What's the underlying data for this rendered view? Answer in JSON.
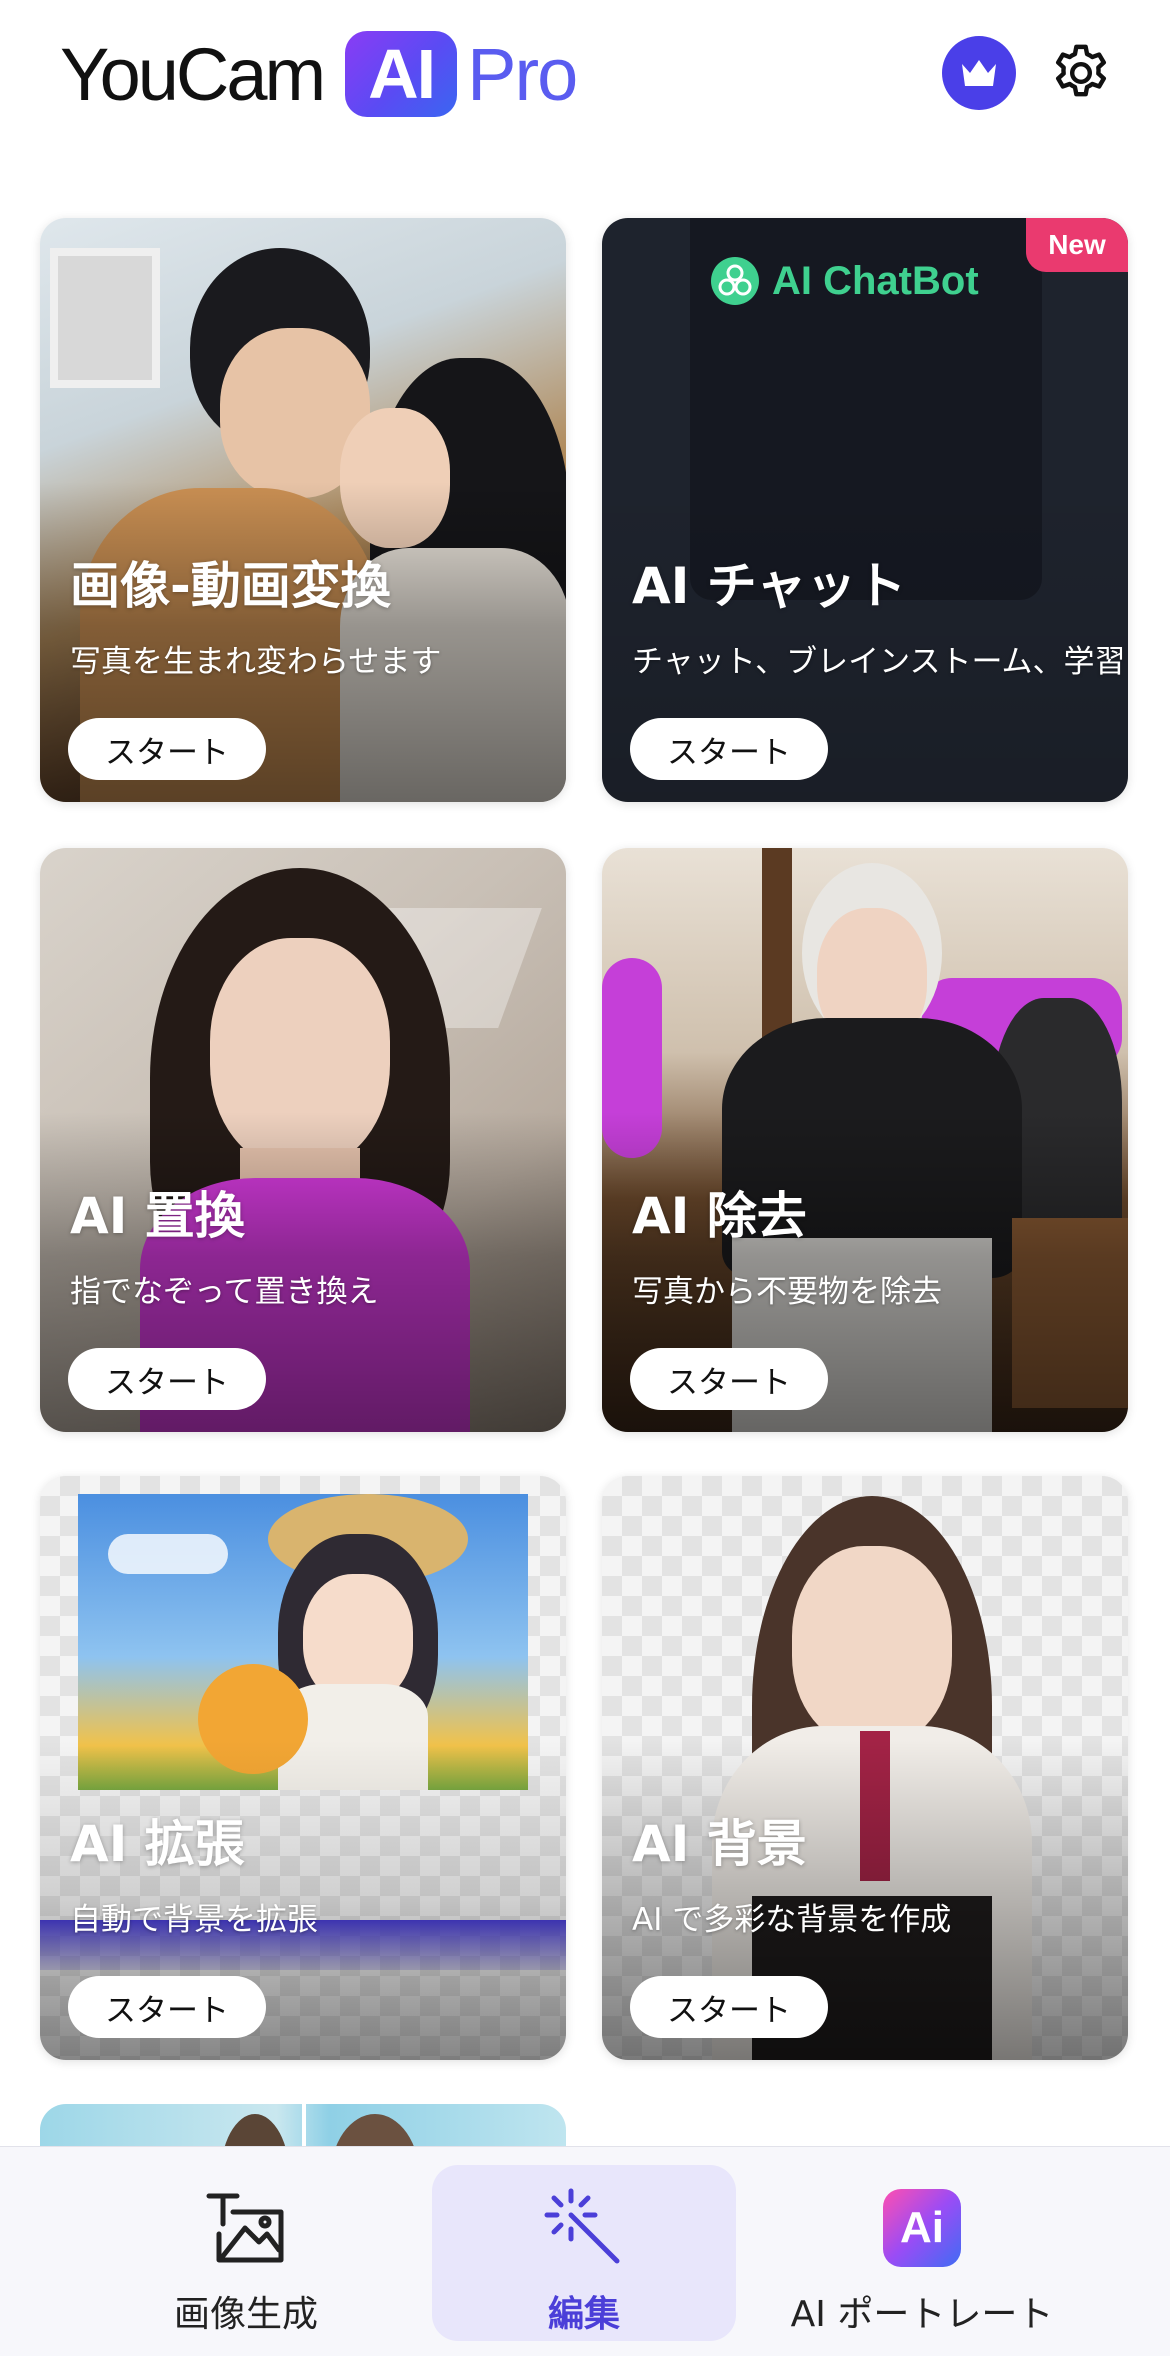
{
  "header": {
    "logo_youcam": "YouCam",
    "logo_ai": "AI",
    "logo_pro": "Pro"
  },
  "cards": [
    {
      "title": "画像-動画変換",
      "subtitle": "写真を生まれ変わらせます",
      "button": "スタート"
    },
    {
      "title": "AI チャット",
      "subtitle": "チャット、ブレインストーム、学習",
      "button": "スタート",
      "badge": "New",
      "banner_text": "AI ChatBot"
    },
    {
      "title": "AI 置換",
      "subtitle": "指でなぞって置き換え",
      "button": "スタート"
    },
    {
      "title": "AI 除去",
      "subtitle": "写真から不要物を除去",
      "button": "スタート"
    },
    {
      "title": "AI 拡張",
      "subtitle": "自動で背景を拡張",
      "button": "スタート"
    },
    {
      "title": "AI 背景",
      "subtitle": "AI で多彩な背景を作成",
      "button": "スタート"
    }
  ],
  "bottom_nav": [
    {
      "label": "画像生成",
      "icon": "text-to-image-icon",
      "active": false
    },
    {
      "label": "編集",
      "icon": "magic-wand-icon",
      "active": true
    },
    {
      "label": "AI ポートレート",
      "icon": "ai-portrait-icon",
      "active": false,
      "icon_text": "Ai"
    }
  ],
  "colors": {
    "accent": "#4b3fd8",
    "crown_bg": "#4a3fe8",
    "new_badge": "#ea3a6f",
    "chatbot_green": "#3fd08f",
    "active_nav_bg": "#e8e6fb"
  }
}
